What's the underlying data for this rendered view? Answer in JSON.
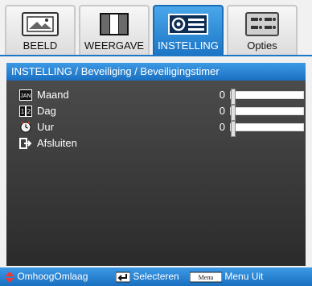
{
  "tabs": [
    {
      "label": "BEELD",
      "icon": "picture-icon"
    },
    {
      "label": "WEERGAVE",
      "icon": "display-icon"
    },
    {
      "label": "INSTELLING",
      "icon": "projector-icon"
    },
    {
      "label": "Opties",
      "icon": "options-icon"
    }
  ],
  "breadcrumb": "INSTELLING / Beveiliging / Beveiligingstimer",
  "rows": [
    {
      "label": "Maand",
      "value": "0",
      "icon": "jan-calendar-icon",
      "icon_text": "JAN",
      "level": 0
    },
    {
      "label": "Dag",
      "value": "0",
      "icon": "day-calendar-icon",
      "icon_text": "12",
      "level": 0
    },
    {
      "label": "Uur",
      "value": "0",
      "icon": "clock-icon",
      "level": 0
    },
    {
      "label": "Afsluiten",
      "icon": "exit-icon"
    }
  ],
  "footer": {
    "updown_label": "OmhoogOmlaag",
    "select_label": "Selecteren",
    "menu_key": "Menu",
    "menu_label": "Menu Uit"
  },
  "colors": {
    "accent": "#1d76c6",
    "panel": "#2b2b2b"
  }
}
